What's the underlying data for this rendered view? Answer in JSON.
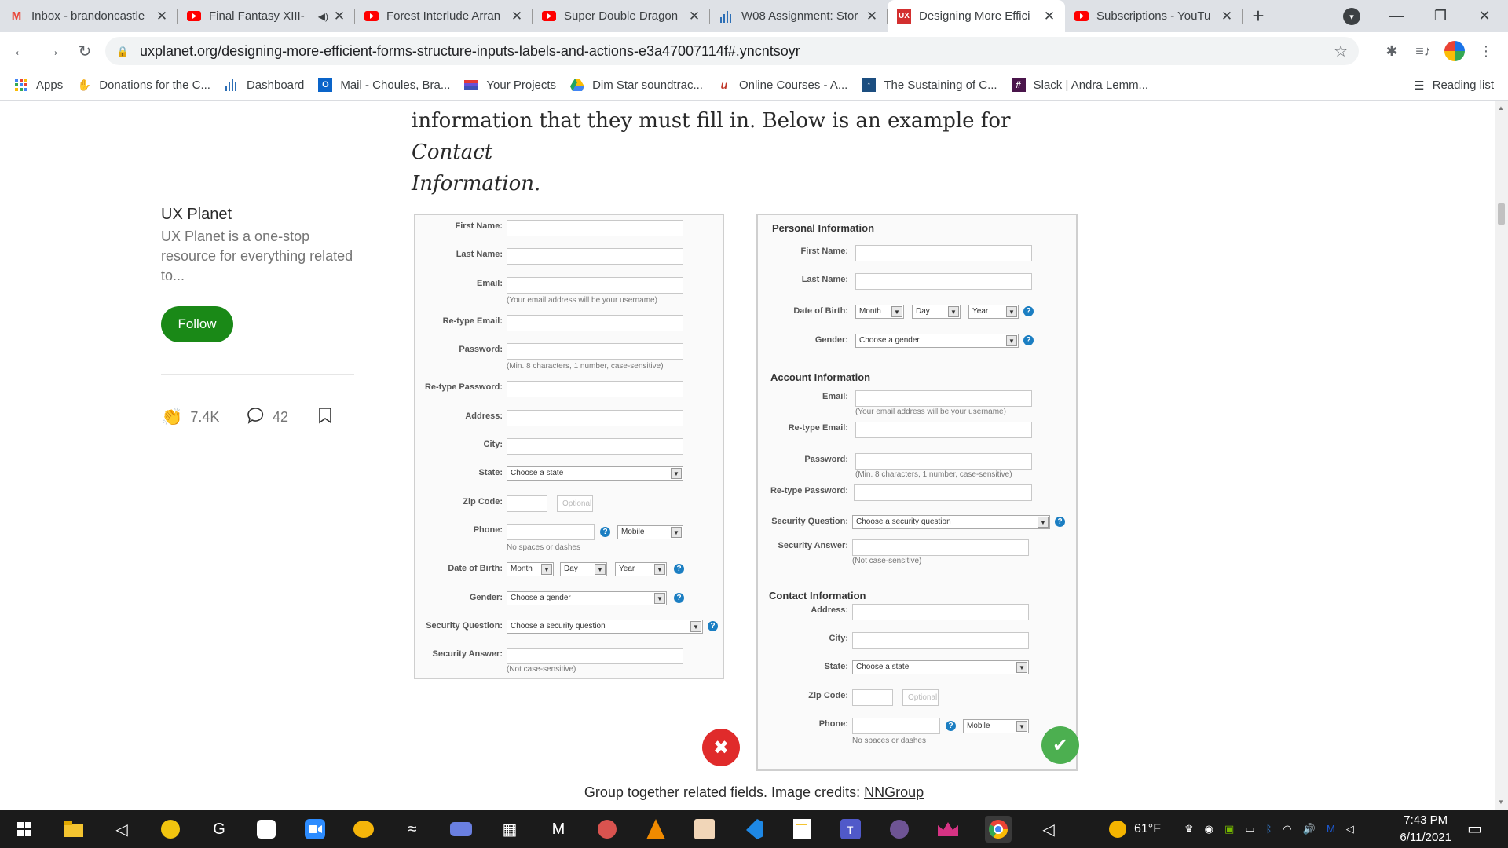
{
  "browser": {
    "tabs": [
      {
        "title": "Inbox - brandoncastle",
        "icon": "gmail-icon",
        "color": "#ea4335"
      },
      {
        "title": "Final Fantasy XIII-",
        "icon": "youtube-icon",
        "color": "#ff0000",
        "audio": "◀)"
      },
      {
        "title": "Forest Interlude Arran",
        "icon": "youtube-icon",
        "color": "#ff0000"
      },
      {
        "title": "Super Double Dragon",
        "icon": "youtube-icon",
        "color": "#ff0000"
      },
      {
        "title": "W08 Assignment: Stor",
        "icon": "canvas-bars-icon",
        "color": "#2d6fb6"
      },
      {
        "title": "Designing More Effici",
        "icon": "ux-icon",
        "color": "#d32f2f",
        "active": true
      },
      {
        "title": "Subscriptions - YouTu",
        "icon": "youtube-icon",
        "color": "#ff0000"
      }
    ],
    "url": "uxplanet.org/designing-more-efficient-forms-structure-inputs-labels-and-actions-e3a47007114f#.yncntsoyr",
    "bookmarks": [
      {
        "label": "Apps",
        "icon": "apps-grid-icon",
        "color": "#4285f4"
      },
      {
        "label": "Donations for the C...",
        "icon": "donation-icon",
        "color": "#000000"
      },
      {
        "label": "Dashboard",
        "icon": "canvas-bars-icon",
        "color": "#2d6fb6"
      },
      {
        "label": "Mail - Choules, Bra...",
        "icon": "outlook-icon",
        "color": "#0a64c9"
      },
      {
        "label": "Your Projects",
        "icon": "projects-icon",
        "color": "#6a4fd6"
      },
      {
        "label": "Dim Star soundtrac...",
        "icon": "drive-icon",
        "color": "#1fa463"
      },
      {
        "label": "Online Courses - A...",
        "icon": "udemy-icon",
        "color": "#c0392b"
      },
      {
        "label": "The Sustaining of C...",
        "icon": "arrow-up-box-icon",
        "color": "#1c4e80"
      },
      {
        "label": "Slack | Andra Lemm...",
        "icon": "slack-icon",
        "color": "#4a154b"
      }
    ],
    "reading_list": "Reading list"
  },
  "article": {
    "text_line1": "information that they must fill in. Below is an example for ",
    "text_italic1": "Contact",
    "text_italic2": "Information",
    "text_end": ".",
    "caption_text": "Group together related fields. Image credits: ",
    "caption_link": "NNGroup"
  },
  "sidebar": {
    "pub_name": "UX Planet",
    "pub_desc": "UX Planet is a one-stop resource for everything related to...",
    "follow": "Follow",
    "claps": "7.4K",
    "responses": "42"
  },
  "left_form": {
    "first_name": "First Name:",
    "last_name": "Last Name:",
    "email": "Email:",
    "email_hint": "(Your email address will be your username)",
    "retype_email": "Re-type Email:",
    "password": "Password:",
    "password_hint": "(Min. 8 characters, 1 number, case-sensitive)",
    "retype_password": "Re-type Password:",
    "address": "Address:",
    "city": "City:",
    "state": "State:",
    "state_select": "Choose a state",
    "zip": "Zip Code:",
    "zip_optional": "Optional",
    "phone": "Phone:",
    "phone_type": "Mobile",
    "phone_hint": "No spaces or dashes",
    "dob": "Date of Birth:",
    "month": "Month",
    "day": "Day",
    "year": "Year",
    "gender": "Gender:",
    "gender_select": "Choose a gender",
    "security_q": "Security Question:",
    "security_q_select": "Choose a security question",
    "security_a": "Security Answer:",
    "security_a_hint": "(Not case-sensitive)"
  },
  "right_form": {
    "personal_title": "Personal Information",
    "first_name": "First Name:",
    "last_name": "Last Name:",
    "dob": "Date of Birth:",
    "month": "Month",
    "day": "Day",
    "year": "Year",
    "gender": "Gender:",
    "gender_select": "Choose a gender",
    "account_title": "Account Information",
    "email": "Email:",
    "email_hint": "(Your email address will be your username)",
    "retype_email": "Re-type Email:",
    "password": "Password:",
    "password_hint": "(Min. 8 characters, 1 number, case-sensitive)",
    "retype_password": "Re-type Password:",
    "security_q": "Security Question:",
    "security_q_select": "Choose a security question",
    "security_a": "Security Answer:",
    "security_a_hint": "(Not case-sensitive)",
    "contact_title": "Contact Information",
    "address": "Address:",
    "city": "City:",
    "state": "State:",
    "state_select": "Choose a state",
    "zip": "Zip Code:",
    "zip_optional": "Optional",
    "phone": "Phone:",
    "phone_type": "Mobile",
    "phone_hint": "No spaces or dashes"
  },
  "taskbar": {
    "weather": "61°F",
    "time": "7:43 PM",
    "date": "6/11/2021"
  }
}
